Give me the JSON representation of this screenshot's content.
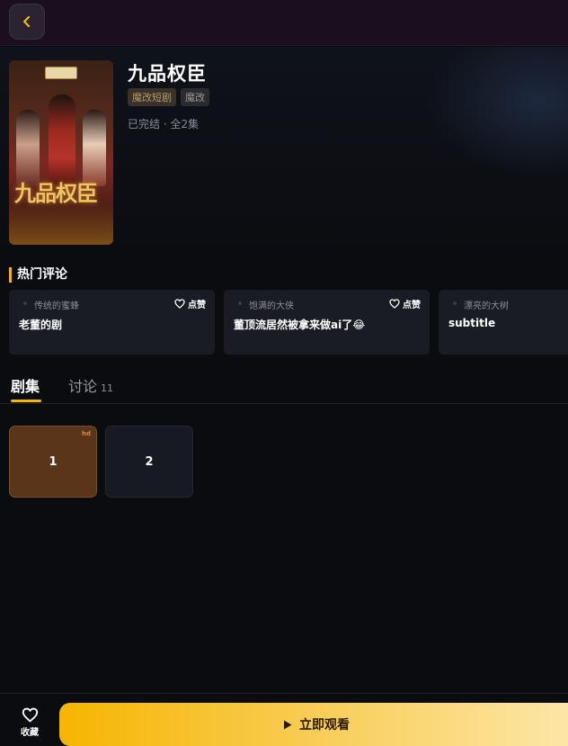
{
  "header": {
    "back_icon": "chevron-left-icon"
  },
  "drama": {
    "title": "九品权臣",
    "poster_title_art": "九品权臣",
    "tags": [
      "魔改短剧",
      "魔改"
    ],
    "status": "已完结 · 全2集"
  },
  "hot_comments": {
    "title": "热门评论",
    "like_label": "点赞",
    "items": [
      {
        "user": "传统的蜜蜂",
        "text": "老董的剧"
      },
      {
        "user": "饱满的大侠",
        "text": "董顶流居然被拿来做ai了😂"
      },
      {
        "user": "漂亮的大树",
        "text": "subtitle"
      }
    ]
  },
  "tabs": {
    "episodes": "剧集",
    "discussion": "讨论",
    "discussion_count": "11"
  },
  "episodes": {
    "items": [
      "1",
      "2"
    ],
    "current_badge": "hd"
  },
  "bottom": {
    "favorite_label": "收藏",
    "watch_label": "立即观看"
  },
  "colors": {
    "accent": "#f5b800",
    "background": "#0b0c10",
    "card": "#1a1c23",
    "current_episode": "#5a3519"
  }
}
